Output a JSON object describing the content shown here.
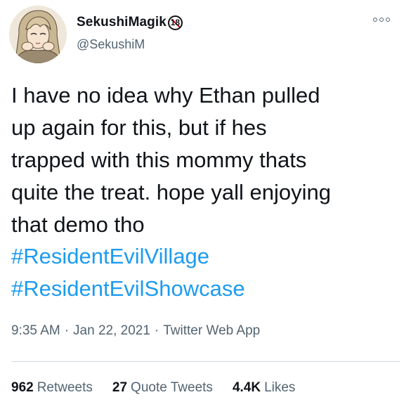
{
  "author": {
    "display_name": "SekushiMagik",
    "badge_text": "18",
    "handle": "@SekushiM",
    "avatar_icon": "anime-portrait-avatar"
  },
  "menu_icon": "more-options-icon",
  "tweet": {
    "text": "I have no idea why Ethan pulled\nup again for this, but if hes\ntrapped with this mommy thats\nquite the treat. hope yall enjoying\nthat demo tho",
    "hashtags": [
      "#ResidentEvilVillage",
      "#ResidentEvilShowcase"
    ]
  },
  "meta": {
    "time": "9:35 AM",
    "separator": "·",
    "date": "Jan 22, 2021",
    "source": "Twitter Web App"
  },
  "stats": {
    "retweets_count": "962",
    "retweets_label": "Retweets",
    "quotes_count": "27",
    "quotes_label": "Quote Tweets",
    "likes_count": "4.4K",
    "likes_label": "Likes"
  },
  "colors": {
    "link": "#1d9bf0",
    "secondary_text": "#536471",
    "primary_text": "#0f1419",
    "divider": "#cfd9de"
  }
}
